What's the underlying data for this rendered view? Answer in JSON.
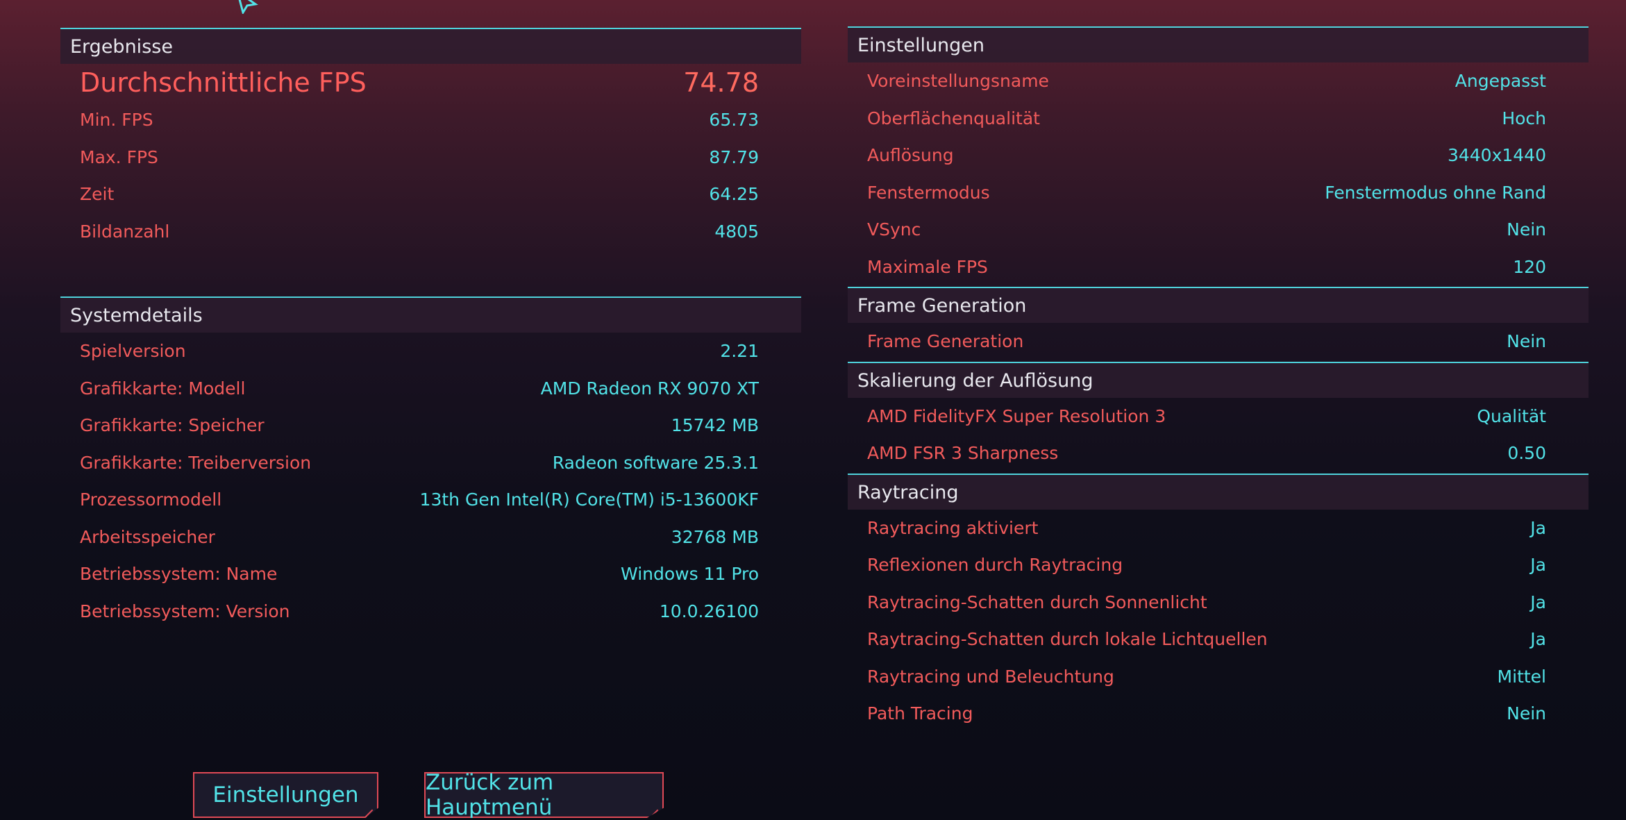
{
  "results": {
    "title": "Ergebnisse",
    "avg_fps_label": "Durchschnittliche FPS",
    "avg_fps_value": "74.78",
    "rows": [
      {
        "label": "Min. FPS",
        "value": "65.73"
      },
      {
        "label": "Max. FPS",
        "value": "87.79"
      },
      {
        "label": "Zeit",
        "value": "64.25"
      },
      {
        "label": "Bildanzahl",
        "value": "4805"
      }
    ]
  },
  "system": {
    "title": "Systemdetails",
    "rows": [
      {
        "label": "Spielversion",
        "value": "2.21"
      },
      {
        "label": "Grafikkarte: Modell",
        "value": "AMD Radeon RX 9070 XT"
      },
      {
        "label": "Grafikkarte: Speicher",
        "value": "15742 MB"
      },
      {
        "label": "Grafikkarte: Treiberversion",
        "value": "Radeon software 25.3.1"
      },
      {
        "label": "Prozessormodell",
        "value": "13th Gen Intel(R) Core(TM) i5-13600KF"
      },
      {
        "label": "Arbeitsspeicher",
        "value": "32768 MB"
      },
      {
        "label": "Betriebssystem: Name",
        "value": "Windows 11 Pro"
      },
      {
        "label": "Betriebssystem: Version",
        "value": "10.0.26100"
      }
    ]
  },
  "settings": {
    "title": "Einstellungen",
    "rows": [
      {
        "label": "Voreinstellungsname",
        "value": "Angepasst"
      },
      {
        "label": "Oberflächenqualität",
        "value": "Hoch"
      },
      {
        "label": "Auflösung",
        "value": "3440x1440"
      },
      {
        "label": "Fenstermodus",
        "value": "Fenstermodus ohne Rand"
      },
      {
        "label": "VSync",
        "value": "Nein"
      },
      {
        "label": "Maximale FPS",
        "value": "120"
      }
    ]
  },
  "frame_generation": {
    "title": "Frame Generation",
    "rows": [
      {
        "label": "Frame Generation",
        "value": "Nein"
      }
    ]
  },
  "scaling": {
    "title": "Skalierung der Auflösung",
    "rows": [
      {
        "label": "AMD FidelityFX Super Resolution 3",
        "value": "Qualität"
      },
      {
        "label": "AMD FSR 3 Sharpness",
        "value": "0.50"
      }
    ]
  },
  "raytracing": {
    "title": "Raytracing",
    "rows": [
      {
        "label": "Raytracing aktiviert",
        "value": "Ja"
      },
      {
        "label": "Reflexionen durch Raytracing",
        "value": "Ja"
      },
      {
        "label": "Raytracing-Schatten durch Sonnenlicht",
        "value": "Ja"
      },
      {
        "label": "Raytracing-Schatten durch lokale Lichtquellen",
        "value": "Ja"
      },
      {
        "label": "Raytracing und Beleuchtung",
        "value": "Mittel"
      },
      {
        "label": "Path Tracing",
        "value": "Nein"
      }
    ]
  },
  "buttons": {
    "settings_label": "Einstellungen",
    "back_label": "Zurück zum Hauptmenü"
  },
  "colors": {
    "accent_cyan": "#52e3e8",
    "label_red": "#f25b5b",
    "border_cyan": "#4fd3dc",
    "button_border": "#e04a56"
  },
  "icons": {
    "cursor": "cursor-arrow-icon"
  }
}
